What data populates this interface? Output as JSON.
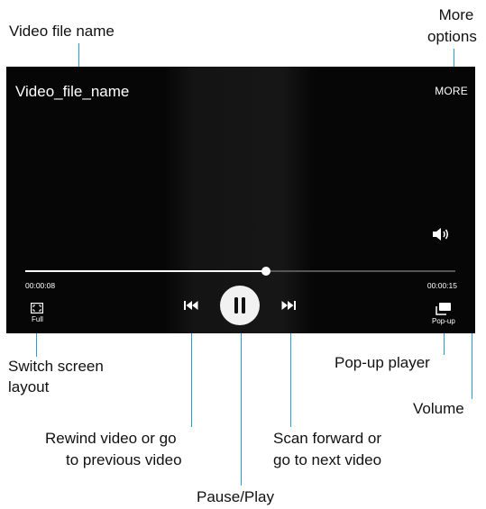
{
  "player": {
    "file_name": "Video_file_name",
    "more_label": "MORE",
    "elapsed": "00:00:08",
    "total": "00:00:15",
    "progress_fraction": 0.56,
    "full_label": "Full",
    "popup_label": "Pop-up"
  },
  "annotations": {
    "video_file_name": "Video file name",
    "more_options_1": "More",
    "more_options_2": "options",
    "switch_layout_1": "Switch screen",
    "switch_layout_2": "layout",
    "popup_player": "Pop-up player",
    "volume": "Volume",
    "rewind_1": "Rewind video or go",
    "rewind_2": "to previous video",
    "scan_1": "Scan forward or",
    "scan_2": "go to next video",
    "pause_play": "Pause/Play"
  },
  "colors": {
    "callout_line": "#2a9fd6",
    "player_bg": "#060606"
  }
}
